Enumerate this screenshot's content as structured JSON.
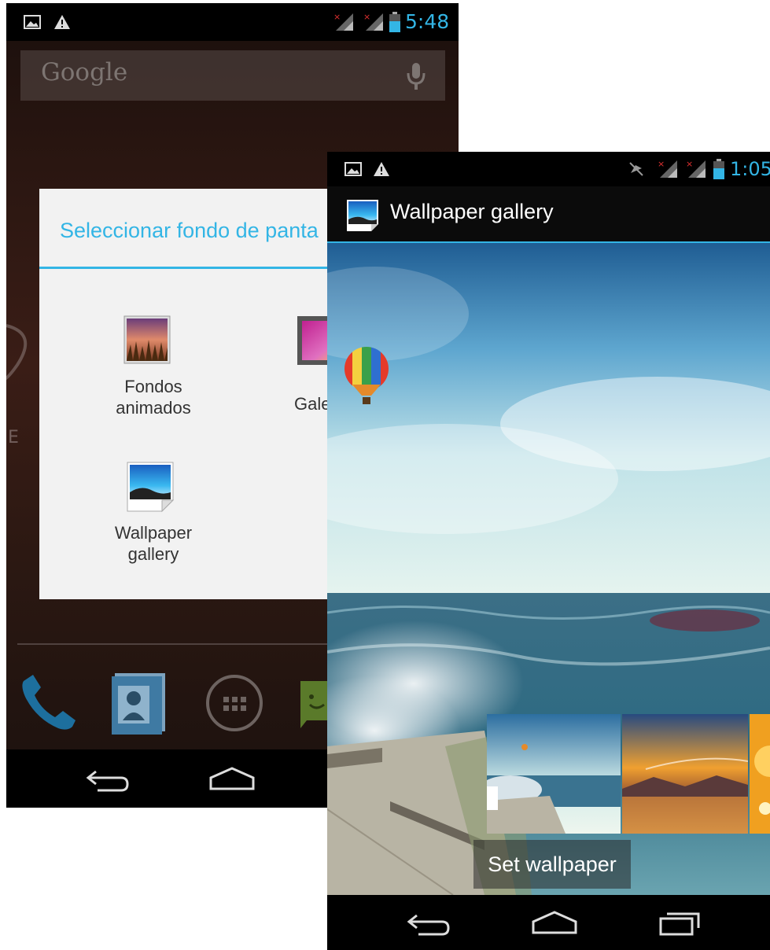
{
  "back_screen": {
    "status_time": "5:48",
    "search_placeholder": "Google",
    "dialog": {
      "title": "Seleccionar fondo de panta",
      "options": [
        {
          "label_line1": "Fondos",
          "label_line2": "animados",
          "icon": "live-wallpaper-icon"
        },
        {
          "label_line1": "Gale",
          "label_line2": "",
          "icon": "gallery-icon"
        },
        {
          "label_line1": "Wallpaper",
          "label_line2": "gallery",
          "icon": "wallpaper-gallery-icon"
        }
      ]
    },
    "partial_background_letters": "E N",
    "dock": [
      "phone-icon",
      "contacts-icon",
      "apps-grid-icon",
      "messaging-icon"
    ],
    "nav": [
      "back-icon",
      "home-icon"
    ]
  },
  "front_screen": {
    "status_time": "1:05",
    "actionbar_title": "Wallpaper gallery",
    "set_wallpaper_label": "Set wallpaper",
    "thumbnails": [
      "thumbnail-beach-balloon",
      "thumbnail-sunset-lake",
      "thumbnail-orange"
    ],
    "nav": [
      "back-icon",
      "home-icon",
      "recent-apps-icon"
    ]
  },
  "colors": {
    "holo_blue": "#33b5e5",
    "status_bar": "#000000",
    "dialog_bg": "#f2f2f2"
  }
}
